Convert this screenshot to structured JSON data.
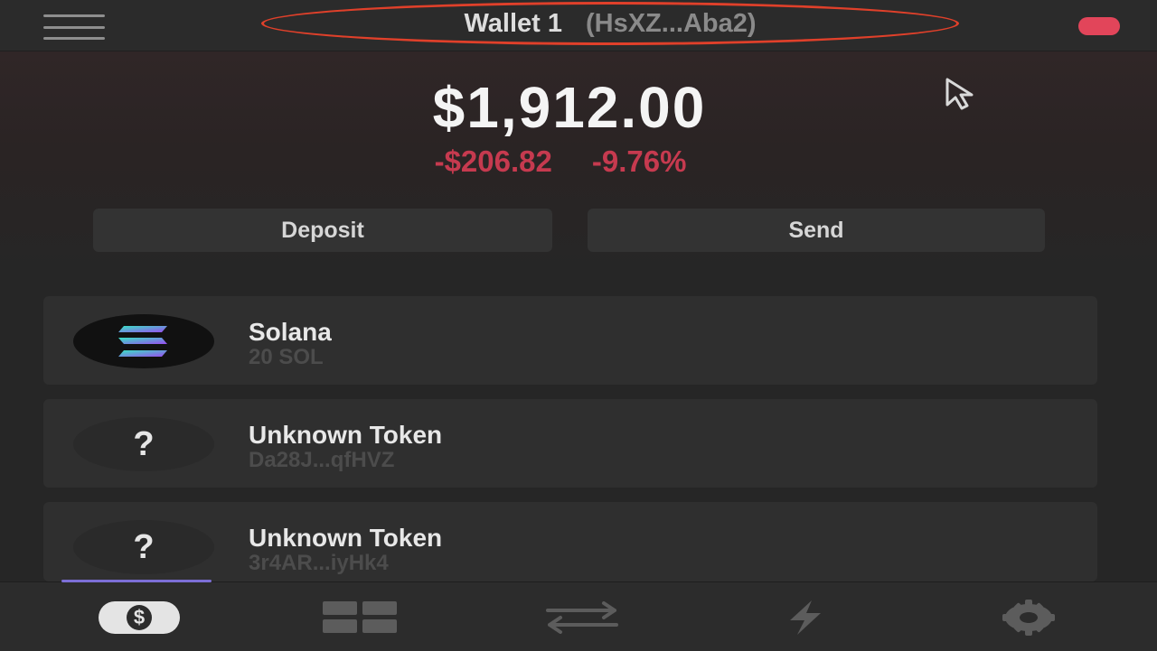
{
  "header": {
    "wallet_name": "Wallet 1",
    "wallet_address": "(HsXZ...Aba2)",
    "menu_icon": "hamburger-menu-icon",
    "status_color": "#e2455a"
  },
  "balance": {
    "total": "$1,912.00",
    "change_amount": "-$206.82",
    "change_percent": "-9.76%",
    "change_color": "#c63a4f"
  },
  "actions": {
    "deposit_label": "Deposit",
    "send_label": "Send"
  },
  "tokens": [
    {
      "name": "Solana",
      "sub": "20 SOL",
      "icon": "solana-icon"
    },
    {
      "name": "Unknown Token",
      "sub": "Da28J...qfHVZ",
      "icon": "unknown-token-icon",
      "glyph": "?"
    },
    {
      "name": "Unknown Token",
      "sub": "3r4AR...iyHk4",
      "icon": "unknown-token-icon",
      "glyph": "?"
    }
  ],
  "tab_bar": {
    "active": "wallet",
    "accent_color": "#7c6fd6",
    "wallet_glyph": "$",
    "tabs": [
      "dollar-icon",
      "apps-grid-icon",
      "swap-arrows-icon",
      "lightning-icon",
      "gear-icon"
    ]
  }
}
